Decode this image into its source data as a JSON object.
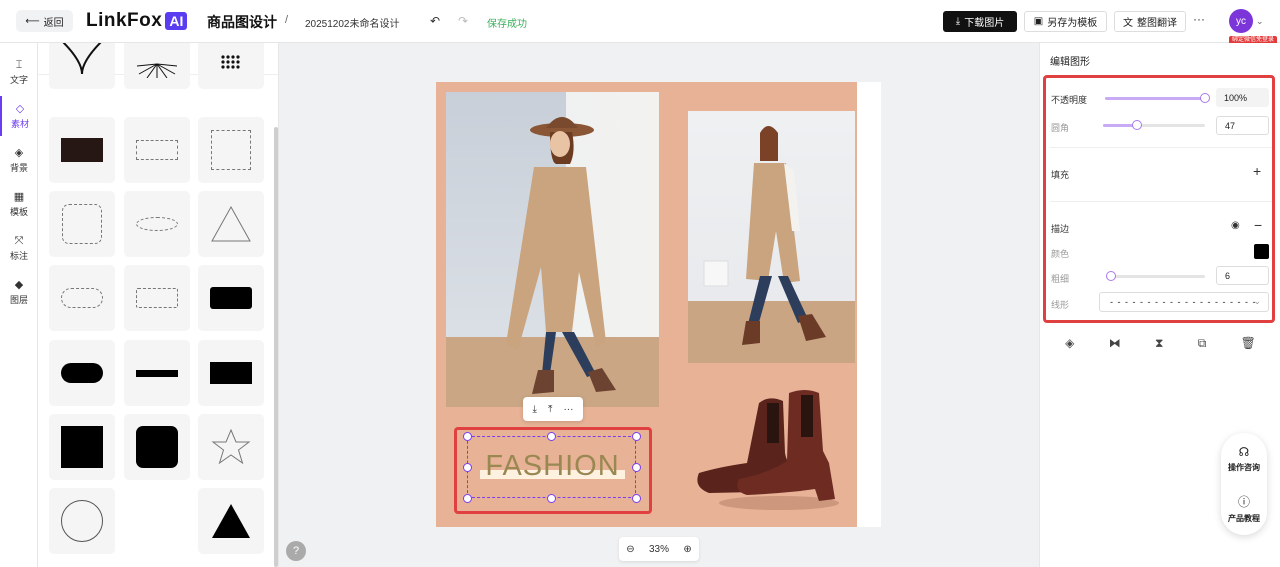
{
  "header": {
    "back_label": "返回",
    "logo_text": "LinkFox",
    "logo_badge": "AI",
    "app_title": "商品图设计",
    "separator": "/",
    "doc_name": "20251202未命名设计",
    "save_status": "保存成功",
    "download_label": "下载图片",
    "save_template_label": "另存为模板",
    "translate_label": "整图翻译",
    "more_label": "···",
    "avatar_text": "yc",
    "bind_badge": "绑定微信免登录"
  },
  "left_nav": [
    {
      "label": "文字",
      "icon": "text-icon"
    },
    {
      "label": "素材",
      "icon": "assets-icon",
      "active": true
    },
    {
      "label": "背景",
      "icon": "background-icon"
    },
    {
      "label": "模板",
      "icon": "template-icon"
    },
    {
      "label": "标注",
      "icon": "annotation-icon"
    },
    {
      "label": "图层",
      "icon": "layers-icon"
    }
  ],
  "asset_panel": {
    "back_icon": "chevron-left-icon"
  },
  "canvas": {
    "text_element": "FASHION",
    "zoom_level": "33%",
    "help_label": "?"
  },
  "right_panel": {
    "title": "编辑图形",
    "opacity_label": "不透明度",
    "opacity_value": "100%",
    "opacity_level": 1.0,
    "radius_label": "圆角",
    "radius_value": "47",
    "radius_level": 0.33,
    "fill_label": "填充",
    "stroke_label": "描边",
    "color_label": "颜色",
    "stroke_color": "#000000",
    "width_label": "粗细",
    "width_value": "6",
    "width_level": 0.03,
    "style_label": "线形",
    "style_value": "- - - - - - - - - - - - - - - - - - - -"
  },
  "floating_help": {
    "consult_label": "操作咨询",
    "tutorial_label": "产品教程"
  },
  "colors": {
    "accent": "#6b3df0",
    "artboard_bg": "#e8b296",
    "highlight_red": "#e04040",
    "success_green": "#3cae5c"
  }
}
